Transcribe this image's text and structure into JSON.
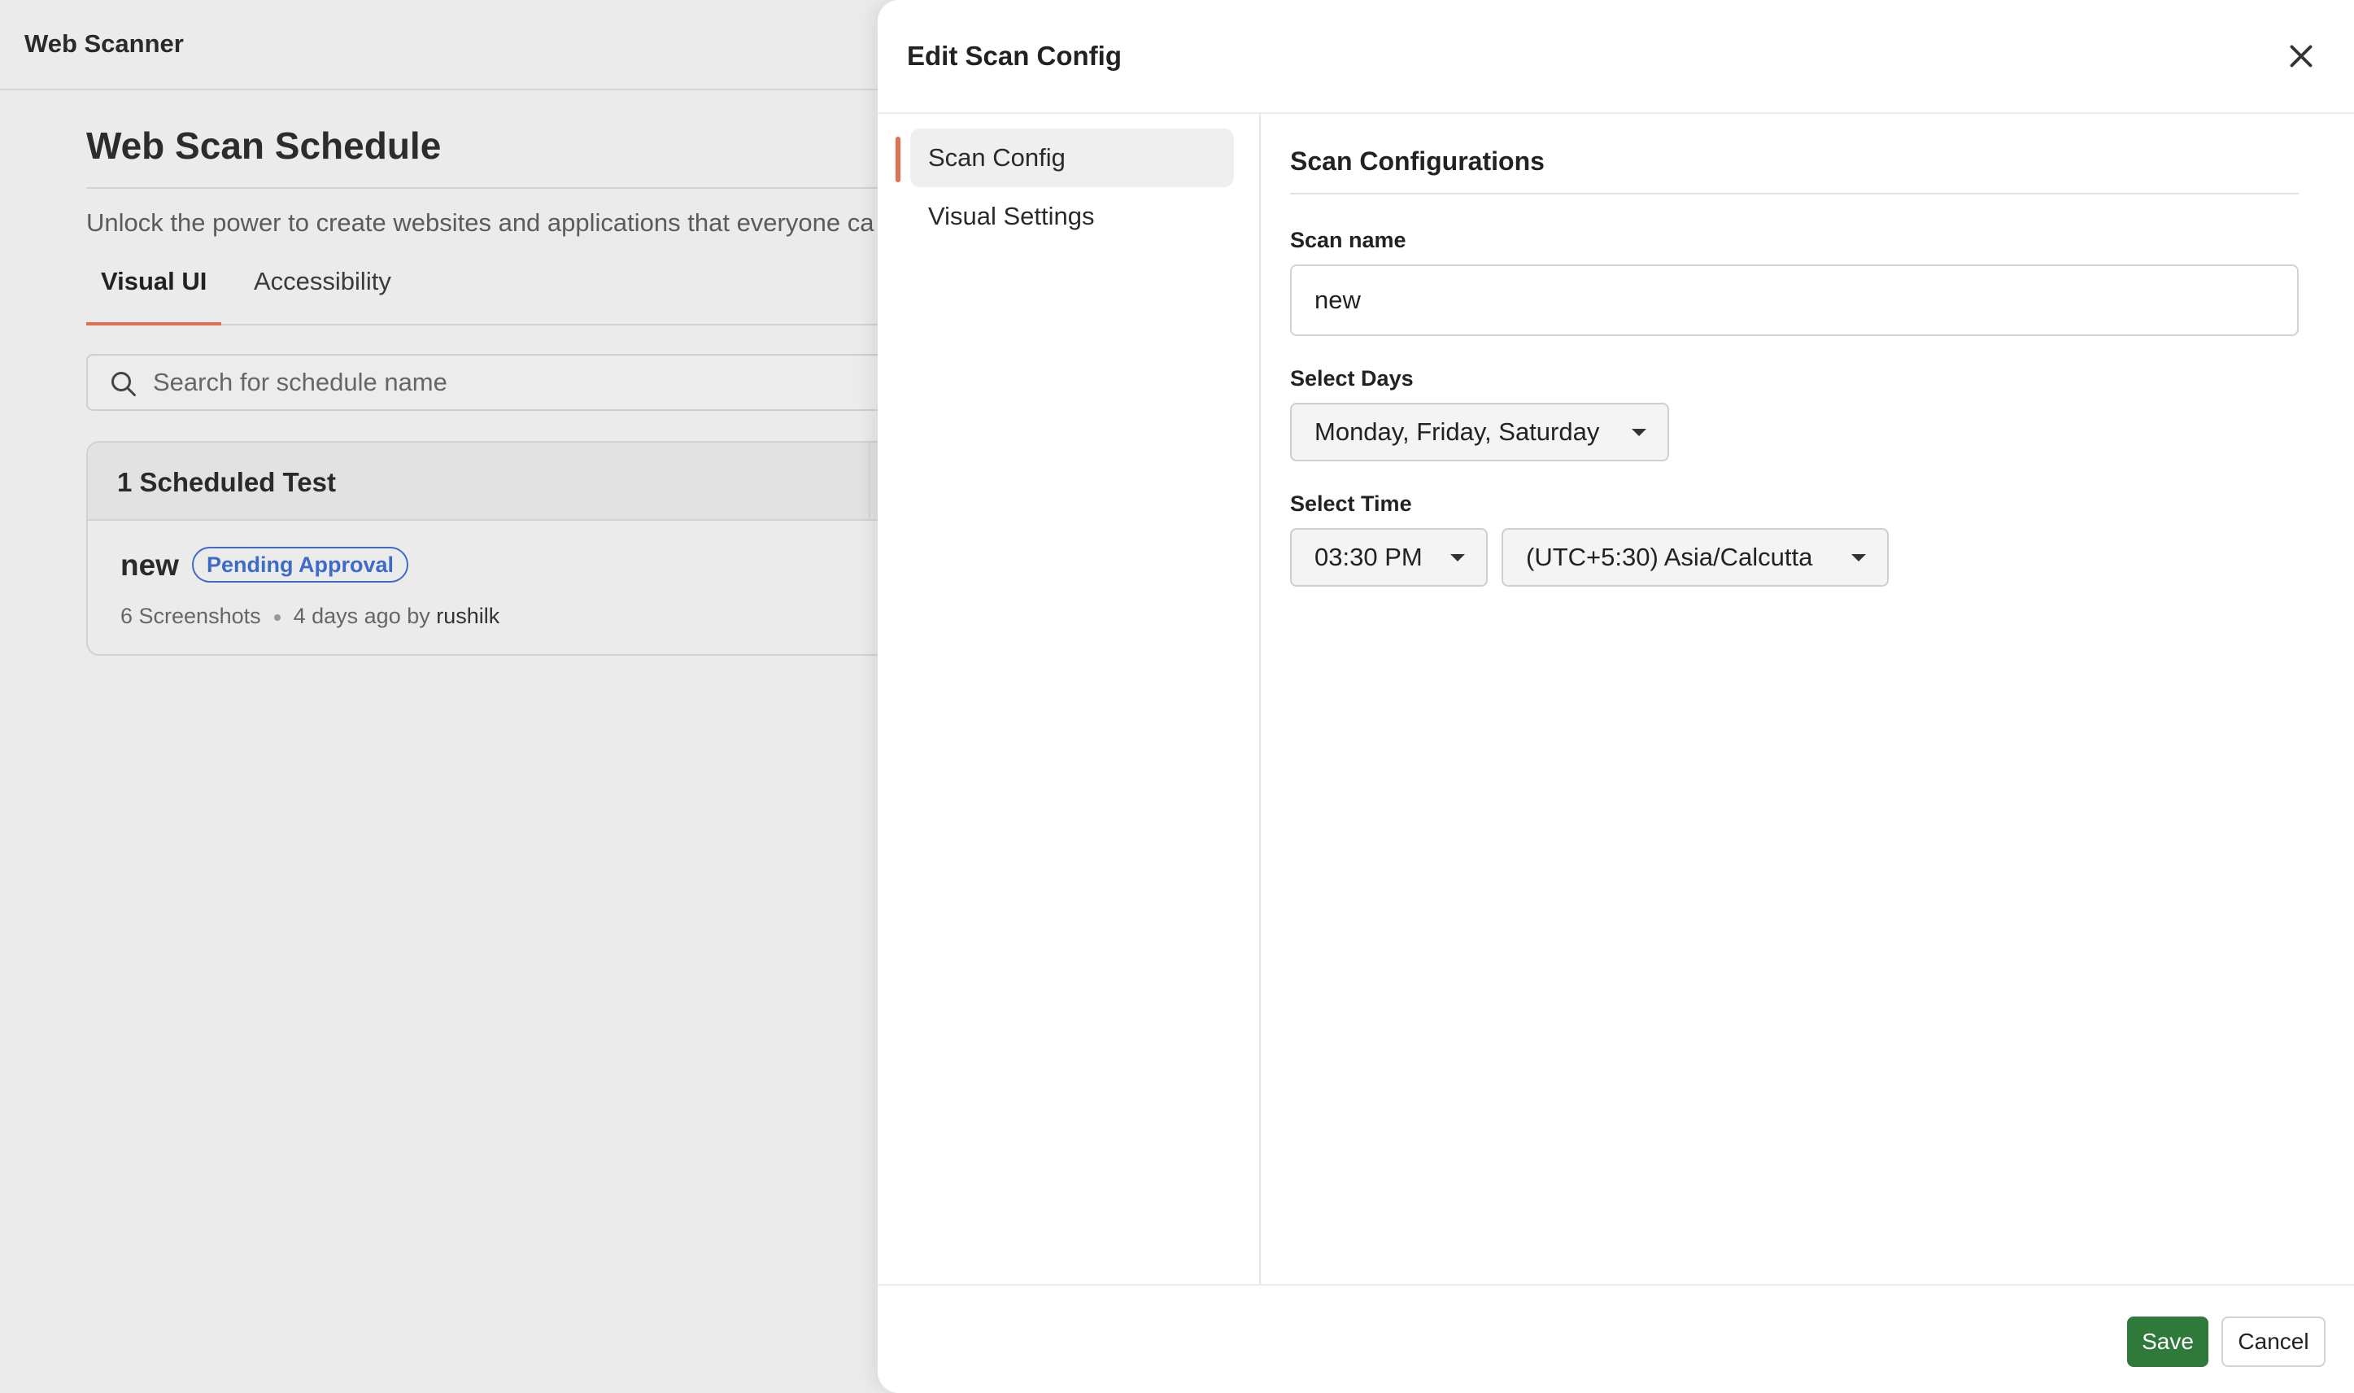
{
  "app": {
    "title": "Web Scanner"
  },
  "page": {
    "title": "Web Scan Schedule",
    "description": "Unlock the power to create websites and applications that everyone ca",
    "tabs": [
      {
        "label": "Visual UI",
        "active": true
      },
      {
        "label": "Accessibility",
        "active": false
      }
    ],
    "search": {
      "placeholder": "Search for schedule name",
      "value": ""
    },
    "scheduled": {
      "header": "1 Scheduled Test",
      "rows": [
        {
          "name": "new",
          "status": "Pending Approval",
          "screenshots": "6 Screenshots",
          "time": "4 days ago by",
          "user": "rushilk"
        }
      ]
    }
  },
  "drawer": {
    "title": "Edit Scan Config",
    "close_icon": "close-icon",
    "nav": [
      {
        "label": "Scan Config",
        "active": true
      },
      {
        "label": "Visual Settings",
        "active": false
      }
    ],
    "section_title": "Scan Configurations",
    "fields": {
      "scan_name": {
        "label": "Scan name",
        "value": "new"
      },
      "days": {
        "label": "Select Days",
        "value": "Monday, Friday, Saturday"
      },
      "time": {
        "label": "Select Time",
        "value": "03:30 PM",
        "timezone": "(UTC+5:30) Asia/Calcutta"
      }
    },
    "footer": {
      "save_label": "Save",
      "cancel_label": "Cancel"
    }
  },
  "colors": {
    "accent": "#e0704f",
    "badge": "#3e6bc6",
    "save": "#2f7a3a"
  }
}
